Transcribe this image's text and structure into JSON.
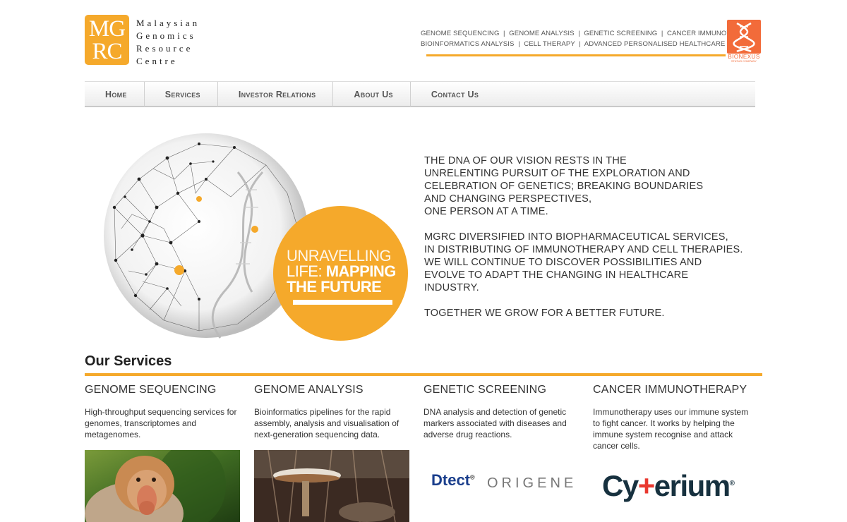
{
  "brand": {
    "logo_line1": "MG",
    "logo_line2": "RC",
    "name_lines": [
      "Malaysian",
      "Genomics",
      "Resource",
      "Centre"
    ],
    "accent": "#f5a92b"
  },
  "tagline": {
    "line1": "GENOME SEQUENCING  |  GENOME ANALYSIS  |  GENETIC SCREENING  |  CANCER IMMUNOTHERAPY",
    "line2": "BIOINFORMATICS ANALYSIS  |  CELL THERAPY  |  ADVANCED PERSONALISED HEALTHCARE",
    "partner_logo": "BIONEXUS",
    "partner_sub": "STATUS COMPANY"
  },
  "nav": [
    "Home",
    "Services",
    "Investor Relations",
    "About Us",
    "Contact Us"
  ],
  "hero": {
    "badge_line1": "UNRAVELLING",
    "badge_line2_a": "LIFE: ",
    "badge_line2_b": "MAPPING",
    "badge_line3": "THE FUTURE",
    "paragraphs": [
      [
        "THE DNA OF OUR VISION RESTS IN THE",
        "UNRELENTING PURSUIT OF THE EXPLORATION AND",
        "CELEBRATION OF GENETICS; BREAKING BOUNDARIES",
        "AND CHANGING PERSPECTIVES,",
        "ONE PERSON AT A TIME."
      ],
      [
        "MGRC DIVERSIFIED INTO BIOPHARMACEUTICAL SERVICES,",
        "IN DISTRIBUTING OF IMMUNOTHERAPY AND CELL THERAPIES.",
        "WE WILL CONTINUE TO DISCOVER POSSIBILITIES AND",
        "EVOLVE TO ADAPT THE CHANGING IN HEALTHCARE",
        "INDUSTRY."
      ],
      [
        "TOGETHER WE GROW FOR A BETTER FUTURE."
      ]
    ]
  },
  "services": {
    "title": "Our Services",
    "items": [
      {
        "title": "GENOME SEQUENCING",
        "desc": "High-throughput sequencing services for genomes, transcriptomes and metagenomes."
      },
      {
        "title": "GENOME ANALYSIS",
        "desc": "Bioinformatics pipelines for the rapid assembly, analysis and visualisation of next-generation sequencing data."
      },
      {
        "title": "GENETIC SCREENING",
        "desc": "DNA analysis and detection of genetic markers associated with diseases and adverse drug reactions."
      },
      {
        "title": "CANCER IMMUNOTHERAPY",
        "desc": "Immunotherapy uses our immune system to fight cancer. It works by helping the immune system recognise and attack cancer cells."
      }
    ],
    "logo_dtect": "Dtect",
    "logo_origene": "ORIGENE",
    "logo_cyt_a": "Cy",
    "logo_cyt_plus": "+",
    "logo_cyt_b": "erium"
  }
}
